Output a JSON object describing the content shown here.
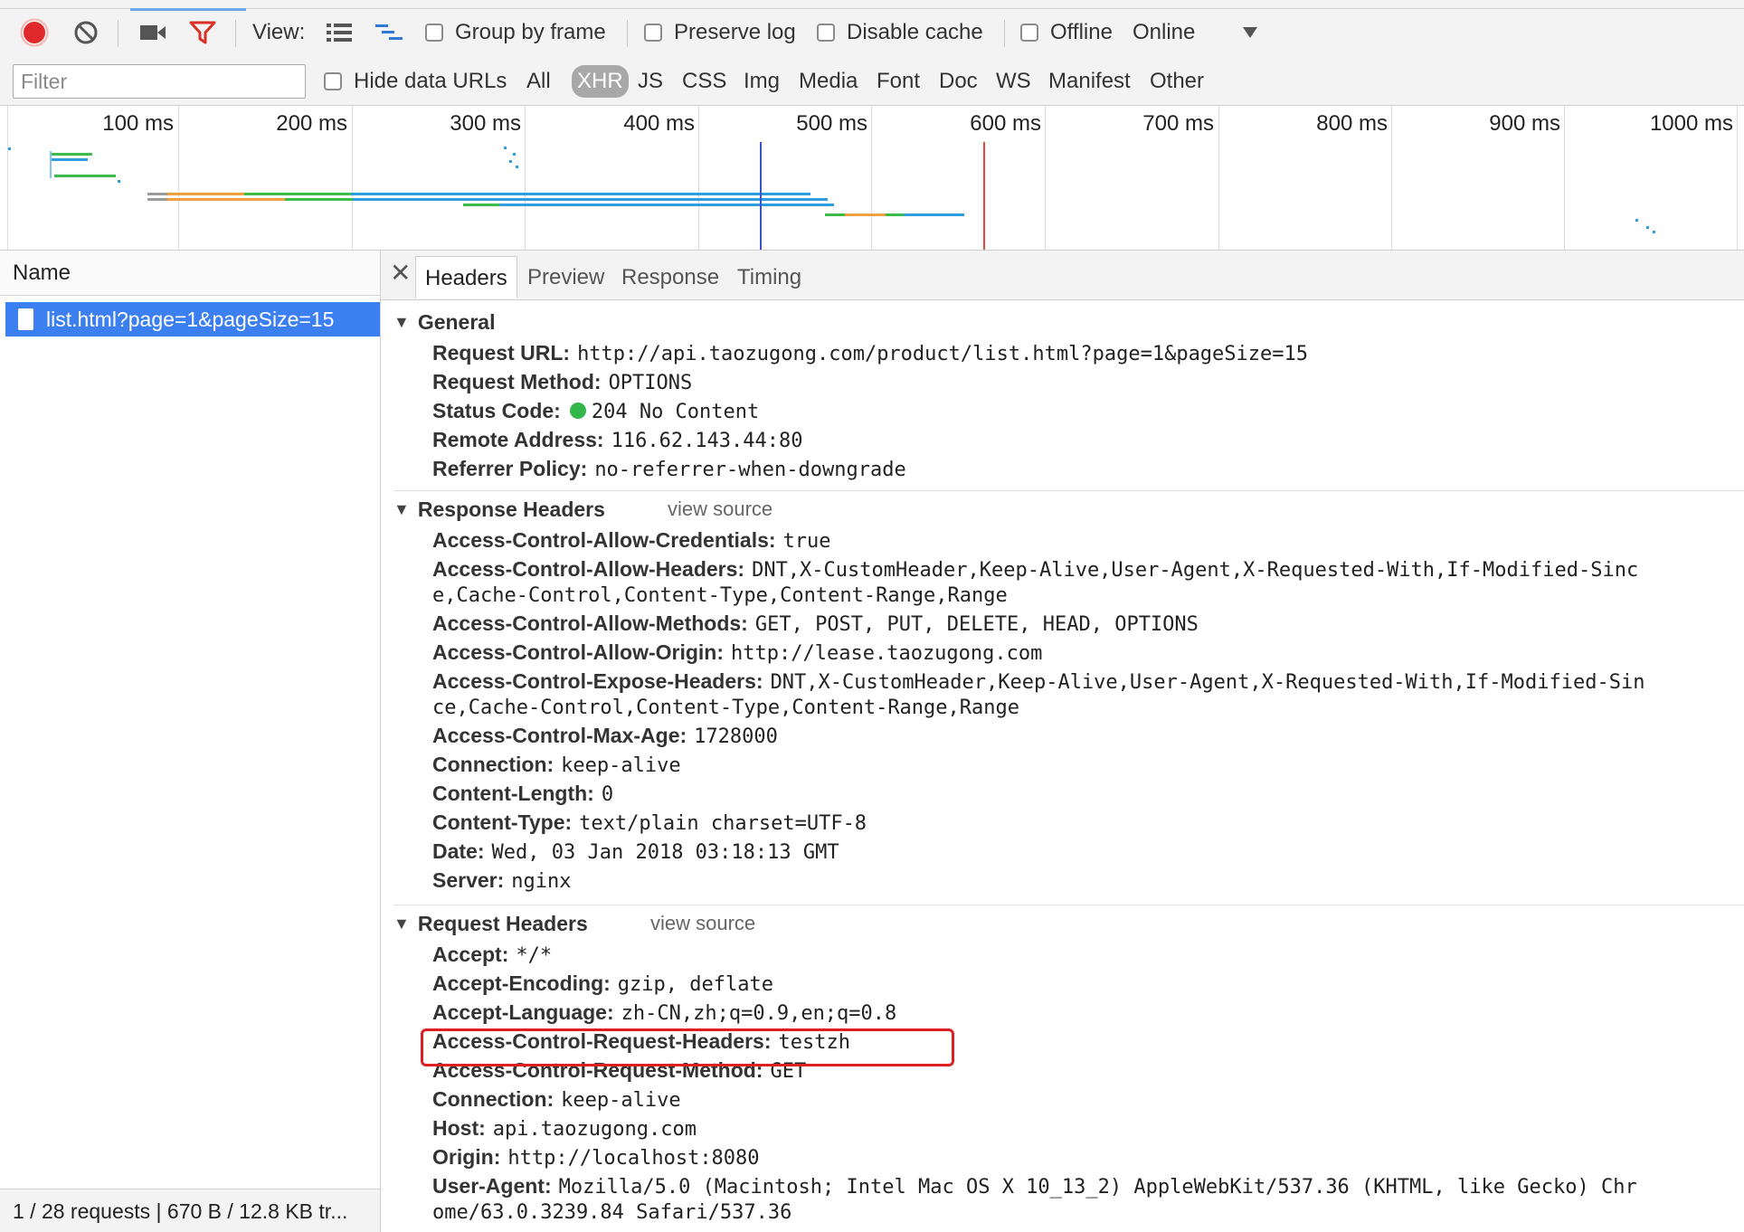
{
  "toolbar": {
    "view_label": "View:",
    "group_by_frame": "Group by frame",
    "preserve_log": "Preserve log",
    "disable_cache": "Disable cache",
    "offline": "Offline",
    "throttling": "Online"
  },
  "filter_bar": {
    "placeholder": "Filter",
    "hide_data_urls": "Hide data URLs",
    "types": [
      "All",
      "XHR",
      "JS",
      "CSS",
      "Img",
      "Media",
      "Font",
      "Doc",
      "WS",
      "Manifest",
      "Other"
    ],
    "active_type": "XHR"
  },
  "overview": {
    "ticks": [
      "100 ms",
      "200 ms",
      "300 ms",
      "400 ms",
      "500 ms",
      "600 ms",
      "700 ms",
      "800 ms",
      "900 ms",
      "1000 ms"
    ]
  },
  "requests": {
    "column_name": "Name",
    "selected_name": "list.html?page=1&pageSize=15",
    "status": "1 / 28 requests | 670 B / 12.8 KB tr..."
  },
  "details": {
    "tabs": [
      "Headers",
      "Preview",
      "Response",
      "Timing"
    ],
    "active_tab": "Headers",
    "general": {
      "title": "General",
      "rows": [
        {
          "key": "Request URL:",
          "value": "http://api.taozugong.com/product/list.html?page=1&pageSize=15"
        },
        {
          "key": "Request Method:",
          "value": "OPTIONS"
        },
        {
          "key": "Status Code:",
          "value": "204 No Content"
        },
        {
          "key": "Remote Address:",
          "value": "116.62.143.44:80"
        },
        {
          "key": "Referrer Policy:",
          "value": "no-referrer-when-downgrade"
        }
      ]
    },
    "response_headers": {
      "title": "Response Headers",
      "view_source": "view source",
      "rows": [
        {
          "key": "Access-Control-Allow-Credentials:",
          "value": "true"
        },
        {
          "key": "Access-Control-Allow-Headers:",
          "value": "DNT,X-CustomHeader,Keep-Alive,User-Agent,X-Requested-With,If-Modified-Sinc",
          "cont": "e,Cache-Control,Content-Type,Content-Range,Range"
        },
        {
          "key": "Access-Control-Allow-Methods:",
          "value": "GET, POST, PUT, DELETE, HEAD, OPTIONS"
        },
        {
          "key": "Access-Control-Allow-Origin:",
          "value": "http://lease.taozugong.com"
        },
        {
          "key": "Access-Control-Expose-Headers:",
          "value": "DNT,X-CustomHeader,Keep-Alive,User-Agent,X-Requested-With,If-Modified-Sin",
          "cont": "ce,Cache-Control,Content-Type,Content-Range,Range"
        },
        {
          "key": "Access-Control-Max-Age:",
          "value": "1728000"
        },
        {
          "key": "Connection:",
          "value": "keep-alive"
        },
        {
          "key": "Content-Length:",
          "value": "0"
        },
        {
          "key": "Content-Type:",
          "value": "text/plain charset=UTF-8"
        },
        {
          "key": "Date:",
          "value": "Wed, 03 Jan 2018 03:18:13 GMT"
        },
        {
          "key": "Server:",
          "value": "nginx"
        }
      ]
    },
    "request_headers": {
      "title": "Request Headers",
      "view_source": "view source",
      "rows": [
        {
          "key": "Accept:",
          "value": "*/*"
        },
        {
          "key": "Accept-Encoding:",
          "value": "gzip, deflate"
        },
        {
          "key": "Accept-Language:",
          "value": "zh-CN,zh;q=0.9,en;q=0.8"
        },
        {
          "key": "Access-Control-Request-Headers:",
          "value": "testzh"
        },
        {
          "key": "Access-Control-Request-Method:",
          "value": "GET"
        },
        {
          "key": "Connection:",
          "value": "keep-alive"
        },
        {
          "key": "Host:",
          "value": "api.taozugong.com"
        },
        {
          "key": "Origin:",
          "value": "http://localhost:8080"
        },
        {
          "key": "User-Agent:",
          "value": "Mozilla/5.0 (Macintosh; Intel Mac OS X 10_13_2) AppleWebKit/537.36 (KHTML, like Gecko) Chr",
          "cont": "ome/63.0.3239.84 Safari/537.36"
        }
      ]
    }
  },
  "colors": {
    "record": "#e0292b",
    "filter_active": "#d93025",
    "selected_row": "#3b7ff0",
    "status_ok": "#33b74a",
    "highlight": "#e02020",
    "bar_blue": "#2f9ee0",
    "bar_green": "#3fbb4c",
    "bar_orange": "#f0a040"
  }
}
